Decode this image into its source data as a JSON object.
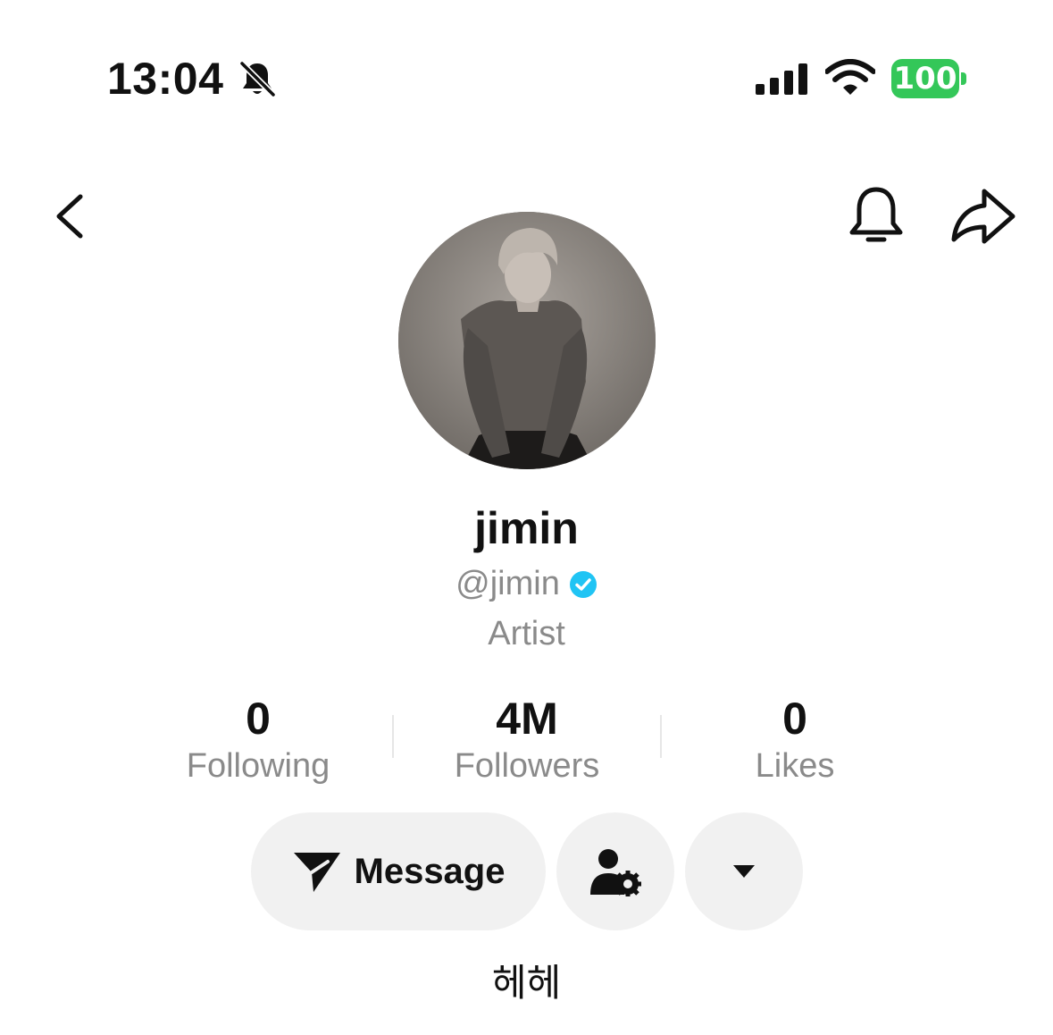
{
  "status_bar": {
    "time": "13:04",
    "silent_icon": "bell-slash-icon",
    "signal_icon": "cellular-signal-icon",
    "wifi_icon": "wifi-icon",
    "battery_level": "100",
    "battery_color": "#34c759"
  },
  "nav": {
    "back_icon": "chevron-left-icon",
    "notify_icon": "bell-icon",
    "share_icon": "share-arrow-icon"
  },
  "profile": {
    "display_name": "jimin",
    "handle": "@jimin",
    "verified_icon": "verified-badge-icon",
    "verified_color": "#20c4f4",
    "category": "Artist",
    "bio": "헤헤"
  },
  "stats": [
    {
      "value": "0",
      "label": "Following"
    },
    {
      "value": "4M",
      "label": "Followers"
    },
    {
      "value": "0",
      "label": "Likes"
    }
  ],
  "actions": {
    "message_label": "Message",
    "message_icon": "send-icon",
    "friend_icon": "user-settings-icon",
    "more_icon": "caret-down-icon"
  }
}
